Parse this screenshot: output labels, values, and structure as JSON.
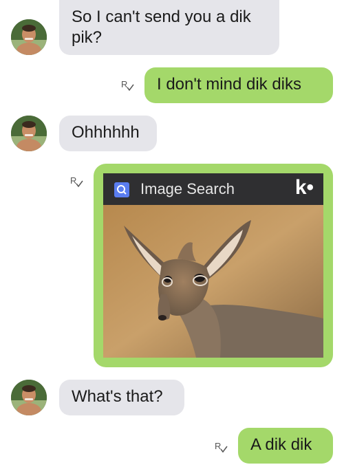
{
  "messages": {
    "m1": "So I can't send you a dik pik?",
    "m2": "I don't mind dik diks",
    "m3": "Ohhhhhh",
    "m5": "What's that?",
    "m6": "A dik dik"
  },
  "image_card": {
    "title": "Image Search",
    "brand": "k•",
    "icon": "image-search-icon"
  },
  "colors": {
    "incoming_bubble": "#e5e5ea",
    "outgoing_bubble": "#a4d86a",
    "card_header": "#2f2f31"
  }
}
